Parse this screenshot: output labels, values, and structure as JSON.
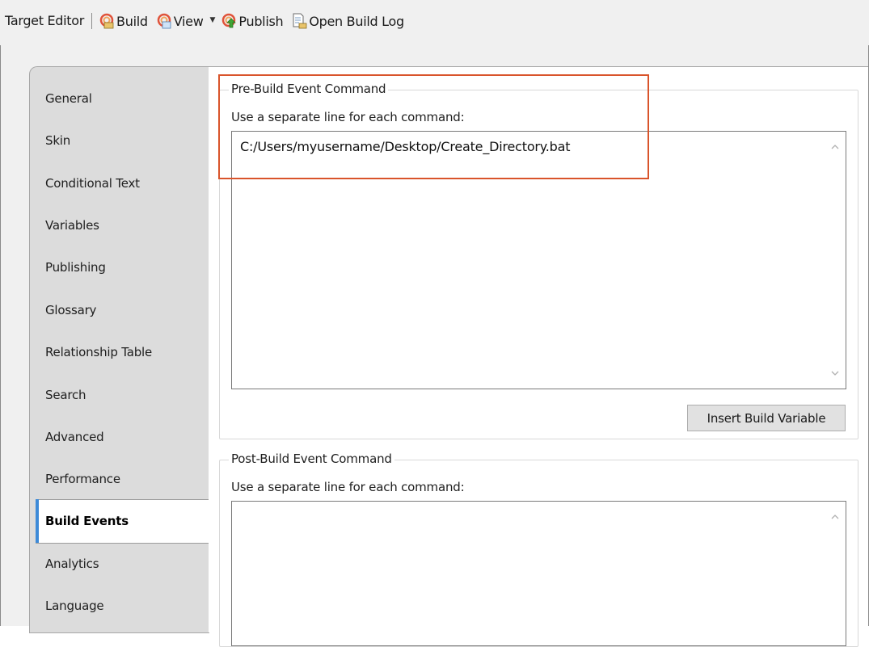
{
  "toolbar": {
    "title": "Target Editor",
    "build_label": "Build",
    "view_label": "View",
    "publish_label": "Publish",
    "open_build_log_label": "Open Build Log",
    "icons": [
      "build-icon",
      "view-icon",
      "dropdown-arrow-icon",
      "publish-icon",
      "build-log-icon"
    ]
  },
  "tabs": [
    {
      "label": "General"
    },
    {
      "label": "Skin"
    },
    {
      "label": "Conditional Text"
    },
    {
      "label": "Variables"
    },
    {
      "label": "Publishing"
    },
    {
      "label": "Glossary"
    },
    {
      "label": "Relationship Table"
    },
    {
      "label": "Search"
    },
    {
      "label": "Advanced"
    },
    {
      "label": "Performance"
    },
    {
      "label": "Build Events"
    },
    {
      "label": "Analytics"
    },
    {
      "label": "Language"
    }
  ],
  "active_tab": "Build Events",
  "pre_build": {
    "legend": "Pre-Build Event Command",
    "hint": "Use a separate line for each command:",
    "value": "C:/Users/myusername/Desktop/Create_Directory.bat",
    "insert_button": "Insert Build Variable"
  },
  "post_build": {
    "legend": "Post-Build Event Command",
    "hint": "Use a separate line for each command:",
    "value": ""
  },
  "colors": {
    "highlight": "#d9542b",
    "active_tab_accent": "#3d8ad8"
  }
}
